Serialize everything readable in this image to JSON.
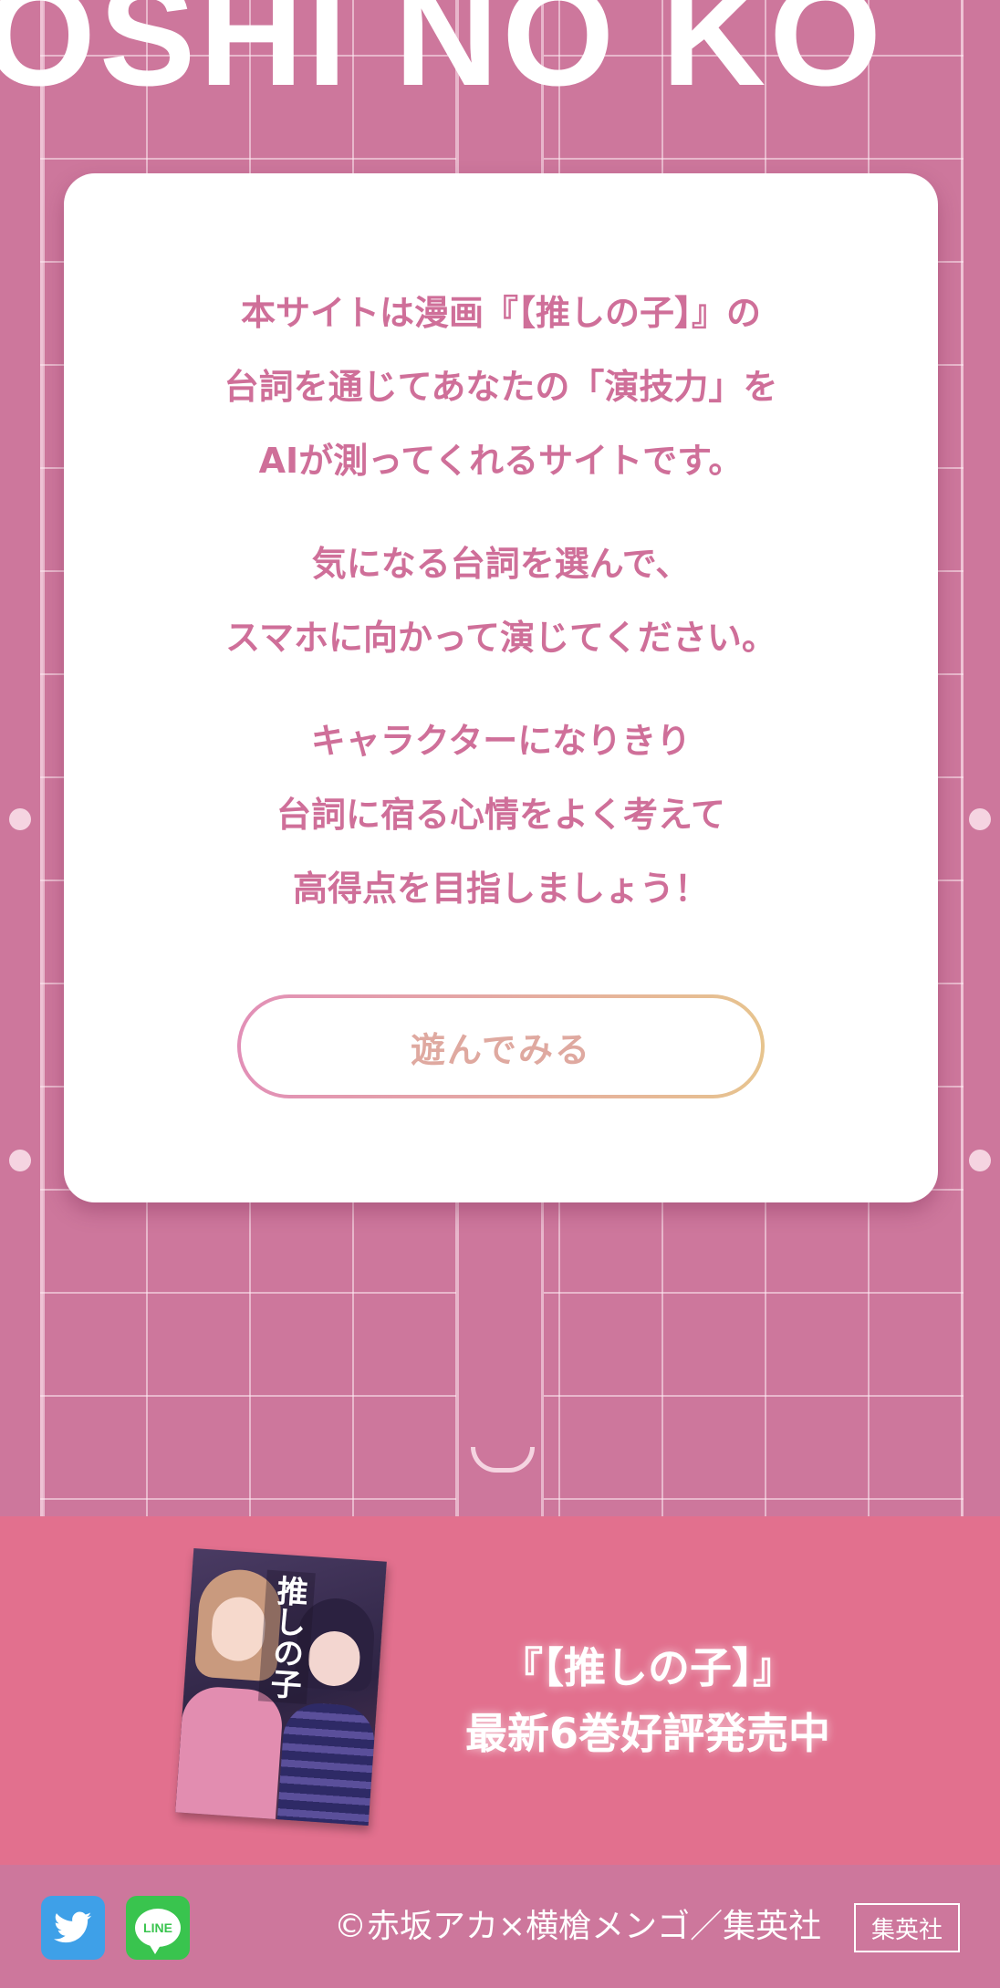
{
  "hero": {
    "logo": "OSHI NO KO"
  },
  "card": {
    "paragraphs": [
      [
        "本サイトは漫画『【推しの子】』の",
        "台詞を通じてあなたの「演技力」を",
        "AIが測ってくれるサイトです。"
      ],
      [
        "気になる台詞を選んで、",
        "スマホに向かって演じてください。"
      ],
      [
        "キャラクターになりきり",
        "台詞に宿る心情をよく考えて",
        "高得点を目指しましょう！"
      ]
    ],
    "play_button": "遊んでみる"
  },
  "promo": {
    "cover": {
      "title": "推しの子"
    },
    "lines": [
      "『【推しの子】』",
      "最新6巻好評発売中"
    ]
  },
  "footer": {
    "twitter_icon": "twitter-icon",
    "line_icon": "line-icon",
    "line_label": "LINE",
    "copyright": "©赤坂アカ×横槍メンゴ／集英社",
    "publisher": "集英社"
  },
  "colors": {
    "background": "#cd779c",
    "card_text": "#cf6f99",
    "promo_band": "#e2708e",
    "twitter": "#3ea0e8",
    "line": "#39c44e"
  }
}
